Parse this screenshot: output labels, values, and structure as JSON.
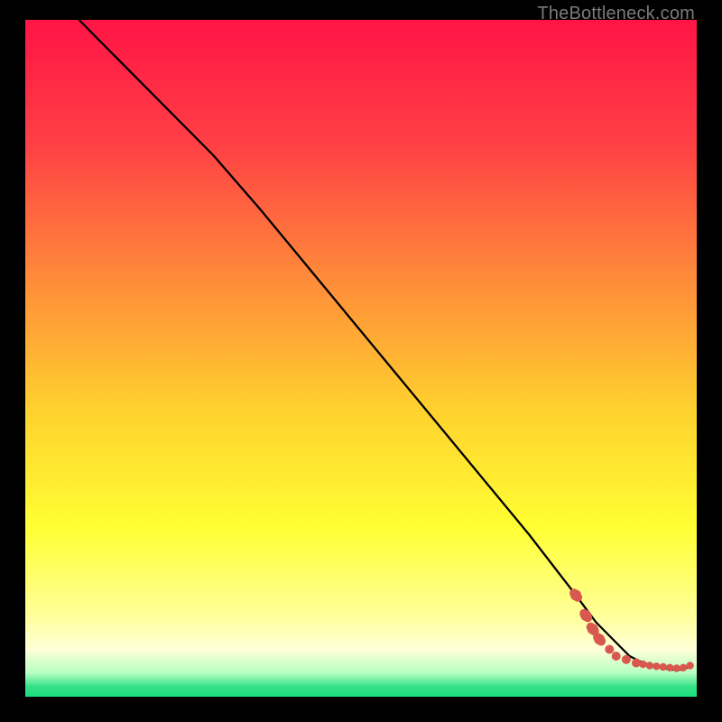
{
  "watermark": "TheBottleneck.com",
  "colors": {
    "top": "#ff1744",
    "mid_upper": "#ff5a3c",
    "mid": "#ffb02e",
    "mid_lower": "#ffe633",
    "pale_yellow": "#ffff8a",
    "green": "#2ce88a",
    "black": "#000000",
    "curve": "#000000",
    "dots": "#d8584f"
  },
  "chart_data": {
    "type": "line",
    "title": "",
    "xlabel": "",
    "ylabel": "",
    "xlim": [
      0,
      100
    ],
    "ylim": [
      0,
      100
    ],
    "series": [
      {
        "name": "bottleneck-curve",
        "x": [
          8,
          28,
          35,
          45,
          55,
          65,
          75,
          82,
          85,
          88,
          90,
          92,
          94,
          96,
          98,
          99
        ],
        "y": [
          100,
          80,
          72,
          60,
          48,
          36,
          24,
          15,
          11,
          8,
          6,
          5,
          4.5,
          4,
          4,
          4.5
        ]
      }
    ],
    "dotted_tail": {
      "name": "tail-points",
      "x": [
        82,
        83.5,
        84.5,
        85.5,
        87,
        88,
        89.5,
        91,
        92,
        93,
        94,
        95,
        96,
        97,
        98,
        99
      ],
      "y": [
        15,
        12,
        10,
        8.5,
        7,
        6,
        5.5,
        5,
        4.8,
        4.6,
        4.5,
        4.4,
        4.3,
        4.2,
        4.3,
        4.6
      ]
    },
    "gradient_stops": [
      {
        "pct": 0,
        "color": "#ff1445"
      },
      {
        "pct": 18,
        "color": "#ff3f45"
      },
      {
        "pct": 38,
        "color": "#ff8a3a"
      },
      {
        "pct": 58,
        "color": "#ffd22e"
      },
      {
        "pct": 75,
        "color": "#ffff33"
      },
      {
        "pct": 88,
        "color": "#ffff99"
      },
      {
        "pct": 93,
        "color": "#ffffd8"
      },
      {
        "pct": 96.5,
        "color": "#b7ffc1"
      },
      {
        "pct": 98.5,
        "color": "#35e089"
      },
      {
        "pct": 100,
        "color": "#1adf7e"
      }
    ]
  }
}
